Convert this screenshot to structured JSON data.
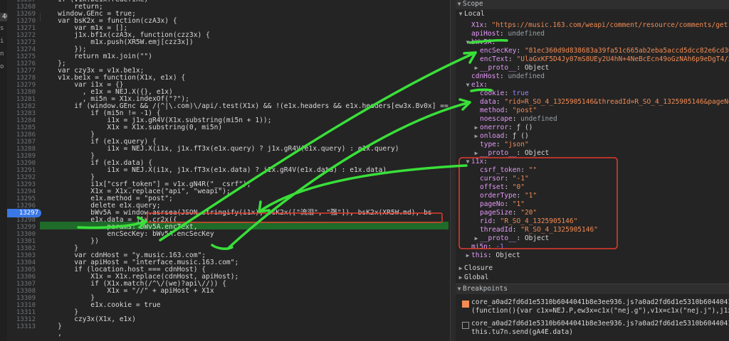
{
  "viewport_badge": "400 * 591",
  "left_tab_letters": [
    "s",
    "i",
    "n",
    "o"
  ],
  "source": {
    "highlighted_line": "13297",
    "lines": [
      {
        "n": "13267",
        "t": "    if (v1x.be1x.redefine)"
      },
      {
        "n": "13268",
        "t": "        return;"
      },
      {
        "n": "13269",
        "t": "    window.GEnc = true;"
      },
      {
        "n": "13270",
        "t": "    var bsK2x = function(czA3x) {"
      },
      {
        "n": "13271",
        "t": "        var m1x = [];"
      },
      {
        "n": "13272",
        "t": "        j1x.bf1x(czA3x, function(czz3x) {"
      },
      {
        "n": "13273",
        "t": "            m1x.push(XR5W.emj[czz3x])"
      },
      {
        "n": "13274",
        "t": "        });"
      },
      {
        "n": "13275",
        "t": "        return m1x.join(\"\")"
      },
      {
        "n": "13276",
        "t": "    };"
      },
      {
        "n": "13277",
        "t": "    var czy3x = v1x.be1x;"
      },
      {
        "n": "13278",
        "t": "    v1x.be1x = function(X1x, e1x) {"
      },
      {
        "n": "13279",
        "t": "        var i1x = {}"
      },
      {
        "n": "13280",
        "t": "          , e1x = NEJ.X({}, e1x)"
      },
      {
        "n": "13281",
        "t": "          , mi5n = X1x.indexOf(\"?\");"
      },
      {
        "n": "13282",
        "t": "        if (window.GEnc && /(^|\\.com)\\/api/.test(X1x) && !(e1x.headers && e1x.headers[ew3x.Bv0x] == ew3x."
      },
      {
        "n": "13283",
        "t": "            if (mi5n != -1) {"
      },
      {
        "n": "13284",
        "t": "                i1x = j1x.gR4V(X1x.substring(mi5n + 1));"
      },
      {
        "n": "13285",
        "t": "                X1x = X1x.substring(0, mi5n)"
      },
      {
        "n": "13286",
        "t": "            }"
      },
      {
        "n": "13287",
        "t": "            if (e1x.query) {"
      },
      {
        "n": "13288",
        "t": "                i1x = NEJ.X(i1x, j1x.fT3x(e1x.query) ? j1x.gR4V(e1x.query) : e1x.query)"
      },
      {
        "n": "13289",
        "t": "            }"
      },
      {
        "n": "13290",
        "t": "            if (e1x.data) {"
      },
      {
        "n": "13291",
        "t": "                i1x = NEJ.X(i1x, j1x.fT3x(e1x.data) ? j1x.gR4V(e1x.data) : e1x.data)"
      },
      {
        "n": "13292",
        "t": "            }"
      },
      {
        "n": "13293",
        "t": "            i1x[\"csrf_token\"] = v1x.gN4R(\"__csrf\");"
      },
      {
        "n": "13294",
        "t": "            X1x = X1x.replace(\"api\", \"weapi\");"
      },
      {
        "n": "13295",
        "t": "            e1x.method = \"post\";"
      },
      {
        "n": "13296",
        "t": "            delete e1x.query;"
      },
      {
        "n": "13297",
        "t": "            bWv5A = window.asrsea(JSON.stringify(i1x), bsK2x([\"流泪\", \"强\"]), bsK2x(XR5W.md), bs"
      },
      {
        "n": "13298",
        "t": "            e1x.data = j1x.cr2x({"
      },
      {
        "n": "13299",
        "t": "                params: bWv5A.encText,"
      },
      {
        "n": "13300",
        "t": "                encSecKey: bWv5A.encSecKey"
      },
      {
        "n": "13301",
        "t": "            })"
      },
      {
        "n": "13302",
        "t": "        }"
      },
      {
        "n": "13303",
        "t": "        var cdnHost = \"y.music.163.com\";"
      },
      {
        "n": "13304",
        "t": "        var apiHost = \"interface.music.163.com\";"
      },
      {
        "n": "13305",
        "t": "        if (location.host === cdnHost) {"
      },
      {
        "n": "13306",
        "t": "            X1x = X1x.replace(cdnHost, apiHost);"
      },
      {
        "n": "13307",
        "t": "            if (X1x.match(/^\\/(we)?api\\//)) {"
      },
      {
        "n": "13308",
        "t": "                X1x = \"//\" + apiHost + X1x"
      },
      {
        "n": "13309",
        "t": "            }"
      },
      {
        "n": "13310",
        "t": "            e1x.cookie = true"
      },
      {
        "n": "13311",
        "t": "        }"
      },
      {
        "n": "13312",
        "t": "        czy3x(X1x, e1x)"
      },
      {
        "n": "13313",
        "t": "    }"
      },
      {
        "n": "",
        "t": "    ,"
      }
    ]
  },
  "scope": {
    "title": "Scope",
    "local_label": "Local",
    "rows": [
      {
        "k": "X1x",
        "v": "\"https://music.163.com/weapi/comment/resource/comments/get\"",
        "vt": "str",
        "d": 1
      },
      {
        "k": "apiHost",
        "v": "undefined",
        "vt": "gray",
        "d": 1
      },
      {
        "k": "bWv5A",
        "v": "",
        "vt": "plain",
        "d": 1,
        "exp": "open"
      },
      {
        "k": "encSecKey",
        "v": "\"81ec360d9d838683a39fa51c665ab2eba5accd5dcc82e6cd362aa",
        "vt": "str",
        "d": 2
      },
      {
        "k": "encText",
        "v": "\"UlaGxKF5D4Jy07mS8UEy2U4hN+4NeBcEcn49oGzNAh6p9eDgT4/xGve",
        "vt": "str",
        "d": 2
      },
      {
        "k": "__proto__",
        "v": "Object",
        "vt": "plain",
        "d": 2,
        "exp": "closed"
      },
      {
        "k": "cdnHost",
        "v": "undefined",
        "vt": "gray",
        "d": 1
      },
      {
        "k": "e1x",
        "v": "",
        "vt": "plain",
        "d": 1,
        "exp": "open"
      },
      {
        "k": "cookie",
        "v": "true",
        "vt": "num",
        "d": 2
      },
      {
        "k": "data",
        "v": "\"rid=R_SO_4_1325905146&threadId=R_SO_4_1325905146&pageNo=1&",
        "vt": "str",
        "d": 2
      },
      {
        "k": "method",
        "v": "\"post\"",
        "vt": "str",
        "d": 2
      },
      {
        "k": "noescape",
        "v": "undefined",
        "vt": "gray",
        "d": 2
      },
      {
        "k": "onerror",
        "v": "ƒ ()",
        "vt": "plain",
        "d": 2,
        "exp": "closed"
      },
      {
        "k": "onload",
        "v": "ƒ ()",
        "vt": "plain",
        "d": 2,
        "exp": "closed"
      },
      {
        "k": "type",
        "v": "\"json\"",
        "vt": "str",
        "d": 2
      },
      {
        "k": "__proto__",
        "v": "Object",
        "vt": "plain",
        "d": 2,
        "exp": "closed"
      },
      {
        "k": "i1x",
        "v": "",
        "vt": "plain",
        "d": 1,
        "exp": "open"
      },
      {
        "k": "csrf_token",
        "v": "\"\"",
        "vt": "str",
        "d": 2
      },
      {
        "k": "cursor",
        "v": "\"-1\"",
        "vt": "str",
        "d": 2
      },
      {
        "k": "offset",
        "v": "\"0\"",
        "vt": "str",
        "d": 2
      },
      {
        "k": "orderType",
        "v": "\"1\"",
        "vt": "str",
        "d": 2
      },
      {
        "k": "pageNo",
        "v": "\"1\"",
        "vt": "str",
        "d": 2
      },
      {
        "k": "pageSize",
        "v": "\"20\"",
        "vt": "str",
        "d": 2
      },
      {
        "k": "rid",
        "v": "\"R_SO_4_1325905146\"",
        "vt": "str",
        "d": 2
      },
      {
        "k": "threadId",
        "v": "\"R_SO_4_1325905146\"",
        "vt": "str",
        "d": 2
      },
      {
        "k": "__proto__",
        "v": "Object",
        "vt": "plain",
        "d": 2,
        "exp": "closed"
      },
      {
        "k": "mi5n",
        "v": "-1",
        "vt": "num",
        "d": 1
      },
      {
        "k": "this",
        "v": "Object",
        "vt": "plain",
        "d": 1,
        "exp": "closed"
      }
    ],
    "closure_label": "Closure",
    "global_label": "Global"
  },
  "breakpoints": {
    "title": "Breakpoints",
    "items": [
      {
        "checked": true,
        "file": "core_a0ad2fd6d1e5310b6044041b8e3ee936.js?a0ad2fd6d1e5310b6044041b8e3ee936:",
        "code": "(function(){var c1x=NEJ.P,ew3x=c1x(\"nej.g\"),v1x=c1x(\"nej.j\"),j1x=c"
      },
      {
        "checked": false,
        "file": "core_a0ad2fd6d1e5310b6044041b8e3ee936.js?a0ad2fd6d1e5310b6044041b8e3ee936:",
        "code": "this.tu7n.send(gA4E.data)"
      }
    ]
  },
  "colors": {
    "highlight_box": "#e53b2c",
    "annotation_green": "#39e039",
    "breakpoint_blue": "#3b78e7"
  }
}
